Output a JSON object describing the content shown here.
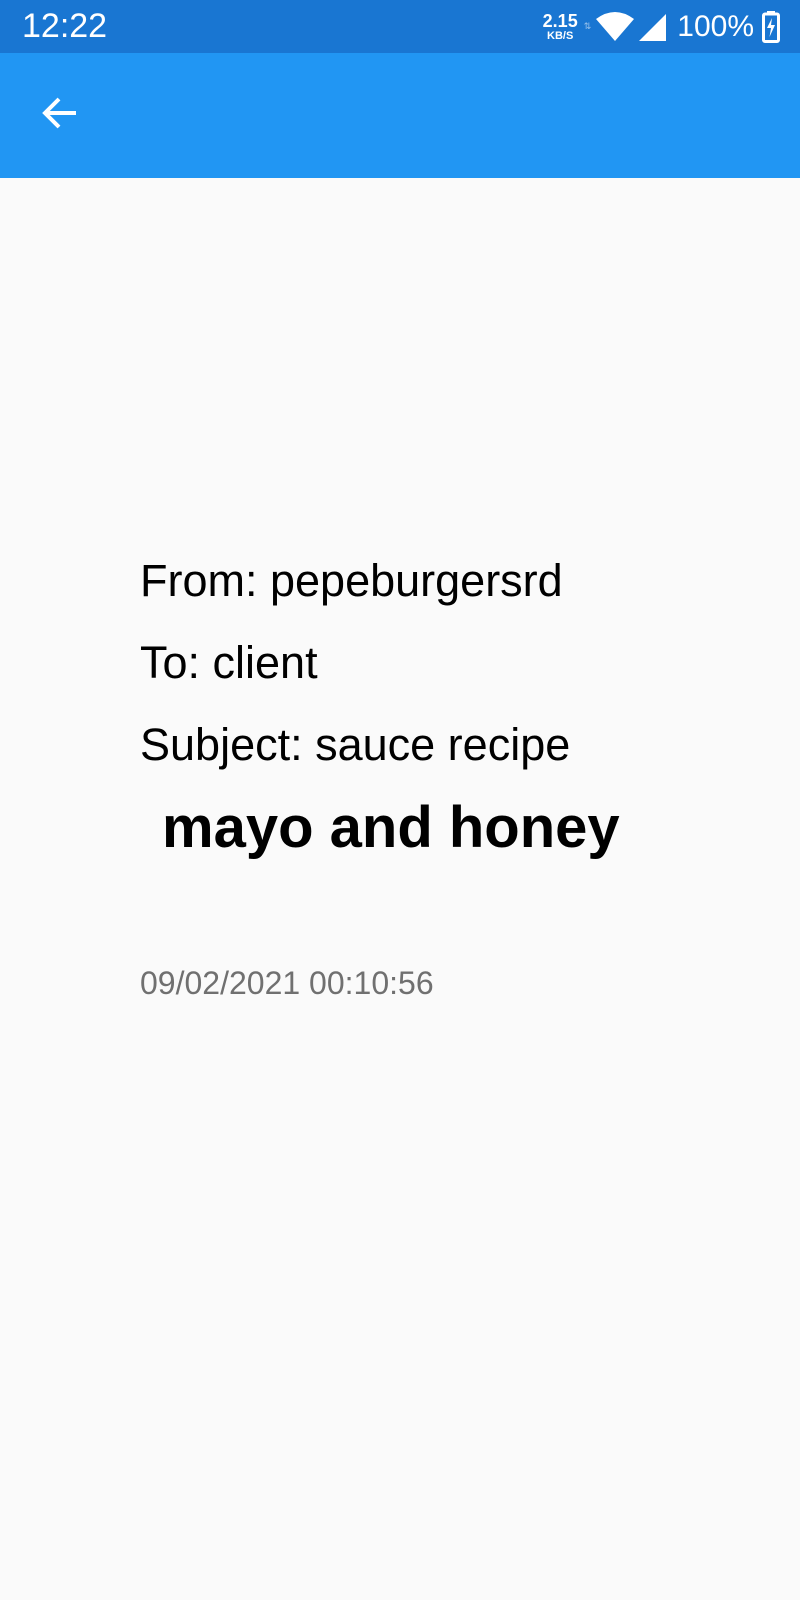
{
  "status_bar": {
    "time": "12:22",
    "net_speed_value": "2.15",
    "net_speed_unit": "KB/S",
    "battery_percent": "100%",
    "icons": [
      "data-transfer-icon",
      "wifi-icon",
      "cell-signal-icon",
      "battery-charging-icon"
    ],
    "color": "#1976d2"
  },
  "app_bar": {
    "color": "#2196f3",
    "back_icon": "arrow-back-icon"
  },
  "mail": {
    "from": "From: pepeburgersrd",
    "to": "To: client",
    "subject": "Subject: sauce recipe",
    "body": "mayo and honey",
    "date": "09/02/2021 00:10:56"
  }
}
